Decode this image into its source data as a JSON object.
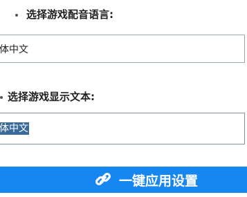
{
  "voice_language": {
    "label": "选择游戏配音语言:",
    "value": "体中文"
  },
  "text_language": {
    "label": "选择游戏显示文本:",
    "value": "体中文"
  },
  "apply_button": {
    "label": "一键应用设置",
    "icon": "link-icon"
  },
  "colors": {
    "accent": "#1686f0",
    "selection": "#3a6a9a",
    "border": "#9aa7b4"
  }
}
